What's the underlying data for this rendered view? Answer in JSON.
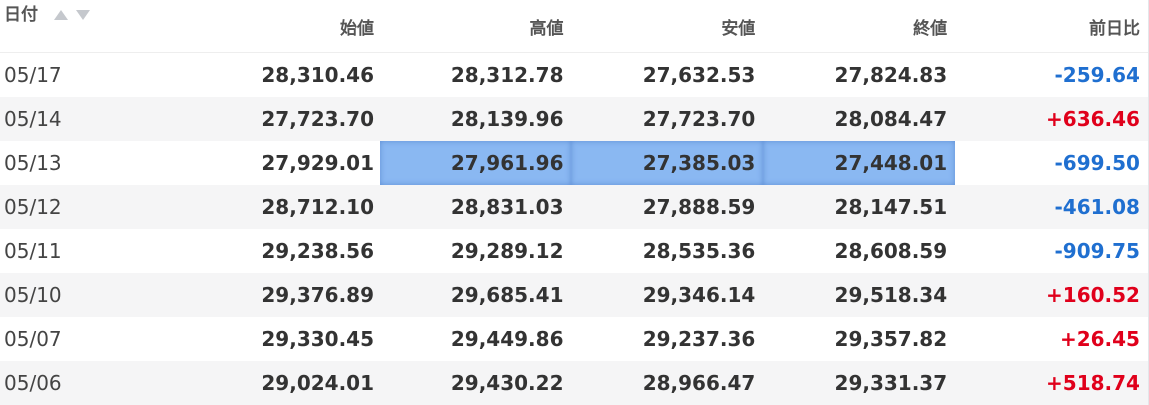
{
  "header": {
    "date_label": "日付",
    "open_label": "始値",
    "high_label": "高値",
    "low_label": "安値",
    "close_label": "終値",
    "change_label": "前日比"
  },
  "rows": [
    {
      "date": "05/17",
      "open": "28,310.46",
      "high": "28,312.78",
      "low": "27,632.53",
      "close": "27,824.83",
      "change": "-259.64",
      "direction": "negative"
    },
    {
      "date": "05/14",
      "open": "27,723.70",
      "high": "28,139.96",
      "low": "27,723.70",
      "close": "28,084.47",
      "change": "+636.46",
      "direction": "positive"
    },
    {
      "date": "05/13",
      "open": "27,929.01",
      "high": "27,961.96",
      "low": "27,385.03",
      "close": "27,448.01",
      "change": "-699.50",
      "direction": "negative"
    },
    {
      "date": "05/12",
      "open": "28,712.10",
      "high": "28,831.03",
      "low": "27,888.59",
      "close": "28,147.51",
      "change": "-461.08",
      "direction": "negative"
    },
    {
      "date": "05/11",
      "open": "29,238.56",
      "high": "29,289.12",
      "low": "28,535.36",
      "close": "28,608.59",
      "change": "-909.75",
      "direction": "negative"
    },
    {
      "date": "05/10",
      "open": "29,376.89",
      "high": "29,685.41",
      "low": "29,346.14",
      "close": "29,518.34",
      "change": "+160.52",
      "direction": "positive"
    },
    {
      "date": "05/07",
      "open": "29,330.45",
      "high": "29,449.86",
      "low": "29,237.36",
      "close": "29,357.82",
      "change": "+26.45",
      "direction": "positive"
    },
    {
      "date": "05/06",
      "open": "29,024.01",
      "high": "29,430.22",
      "low": "28,966.47",
      "close": "29,331.37",
      "change": "+518.74",
      "direction": "positive"
    }
  ],
  "colors": {
    "negative": "#1f6fd0",
    "positive": "#e0001b",
    "selection": "#8ab8f2"
  },
  "icons": {
    "sort_asc": "sort-ascending-icon",
    "sort_desc": "sort-descending-icon"
  }
}
